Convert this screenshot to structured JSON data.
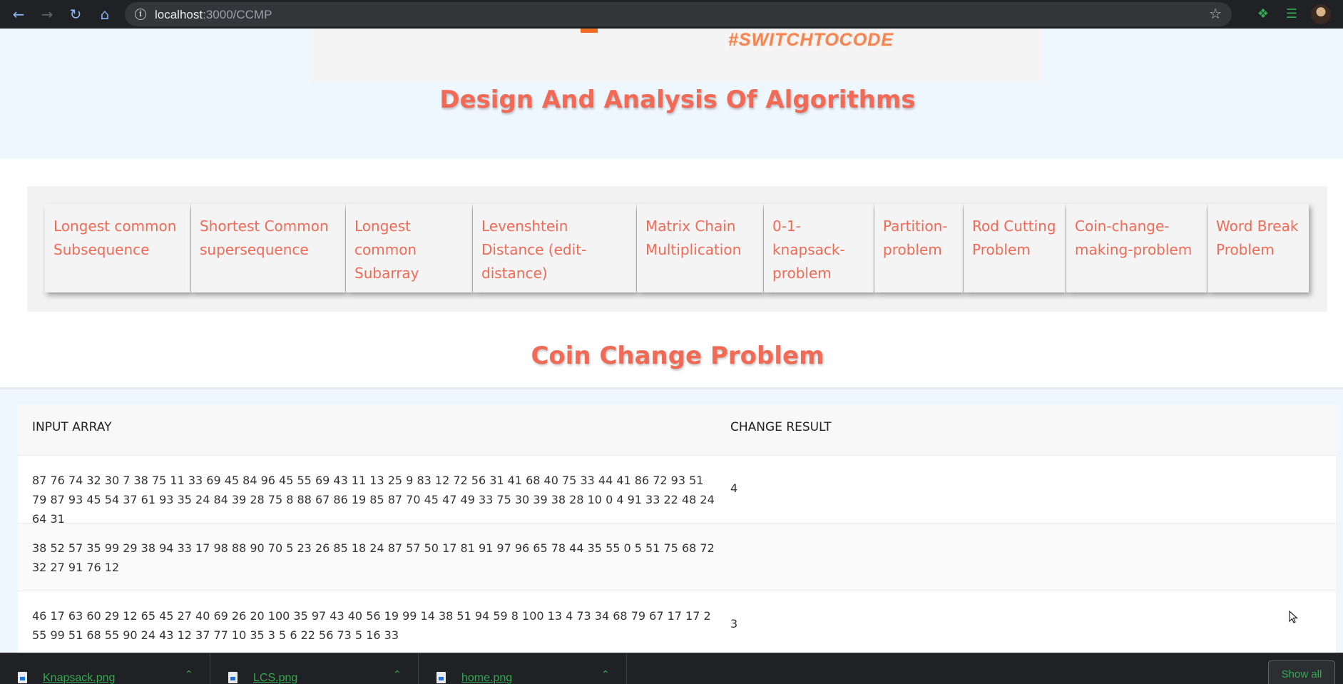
{
  "browser": {
    "url_host": "localhost",
    "url_path": ":3000/CCMP"
  },
  "header": {
    "tagline": "#SWITCHTOCODE",
    "title": "Design And Analysis Of Algorithms"
  },
  "nav": {
    "items": [
      {
        "label": "Longest common Subsequence"
      },
      {
        "label": "Shortest Common supersequence"
      },
      {
        "label": "Longest common Subarray"
      },
      {
        "label": "Levenshtein Distance (edit-distance)"
      },
      {
        "label": "Matrix Chain Multiplication"
      },
      {
        "label": "0-1-knapsack-problem"
      },
      {
        "label": "Partition-problem"
      },
      {
        "label": "Rod Cutting Problem"
      },
      {
        "label": "Coin-change-making-problem"
      },
      {
        "label": "Word Break Problem"
      }
    ]
  },
  "section": {
    "title": "Coin Change Problem"
  },
  "table": {
    "headers": [
      "INPUT ARRAY",
      "CHANGE RESULT"
    ],
    "rows": [
      {
        "input": "87 76 74 32 30 7 38 75 11 33 69 45 84 96 45 55 69 43 11 13 25 9 83 12 72 56 31 41 68 40 75 33 44 41 86 72 93 51 79 87 93 45 54 37 61 93 35 24 84 39 28 75 8 88 67 86 19 85 87 70 45 47 49 33 75 30 39 38 28 10 0 4 91 33 22 48 24 64 31",
        "result": "4"
      },
      {
        "input": "38 52 57 35 99 29 38 94 33 17 98 88 90 70 5 23 26 85 18 24 87 57 50 17 81 91 97 96 65 78 44 35 55 0 5 51 75 68 72 32 27 91 76 12",
        "result": ""
      },
      {
        "input": "46 17 63 60 29 12 65 45 27 40 69 26 20 100 35 97 43 40 56 19 99 14 38 51 94 59 8 100 13 4 73 34 68 79 67 17 17 2 55 99 51 68 55 90 24 43 12 37 77 10 35 3 5 6 22 56 73 5 16 33",
        "result": "3"
      }
    ]
  },
  "downloads": {
    "items": [
      {
        "name": "Knapsack.png"
      },
      {
        "name": "LCS.png"
      },
      {
        "name": "home.png"
      }
    ],
    "show_all_label": "Show all"
  }
}
